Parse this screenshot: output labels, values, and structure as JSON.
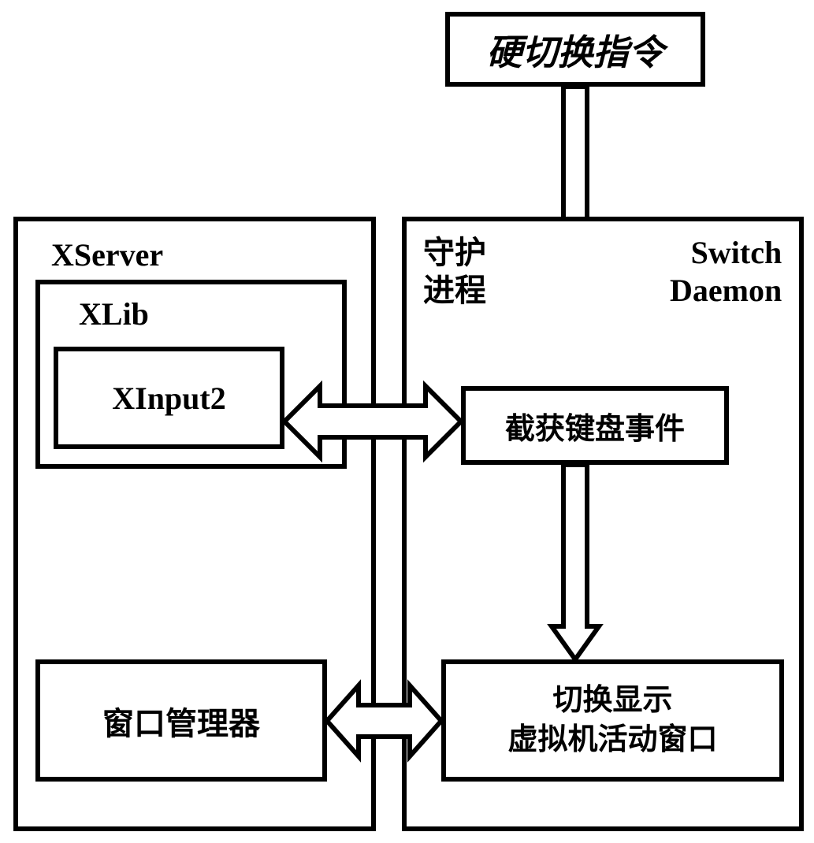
{
  "boxes": {
    "top": "硬切换指令",
    "xserver_label": "XServer",
    "xlib_label": "XLib",
    "xinput2": "XInput2",
    "window_manager": "窗口管理器",
    "daemon_label_cn": "守护\n进程",
    "daemon_label_en": "Switch\nDaemon",
    "intercept_keyboard": "截获键盘事件",
    "switch_display_line1": "切换显示",
    "switch_display_line2": "虚拟机活动窗口"
  }
}
